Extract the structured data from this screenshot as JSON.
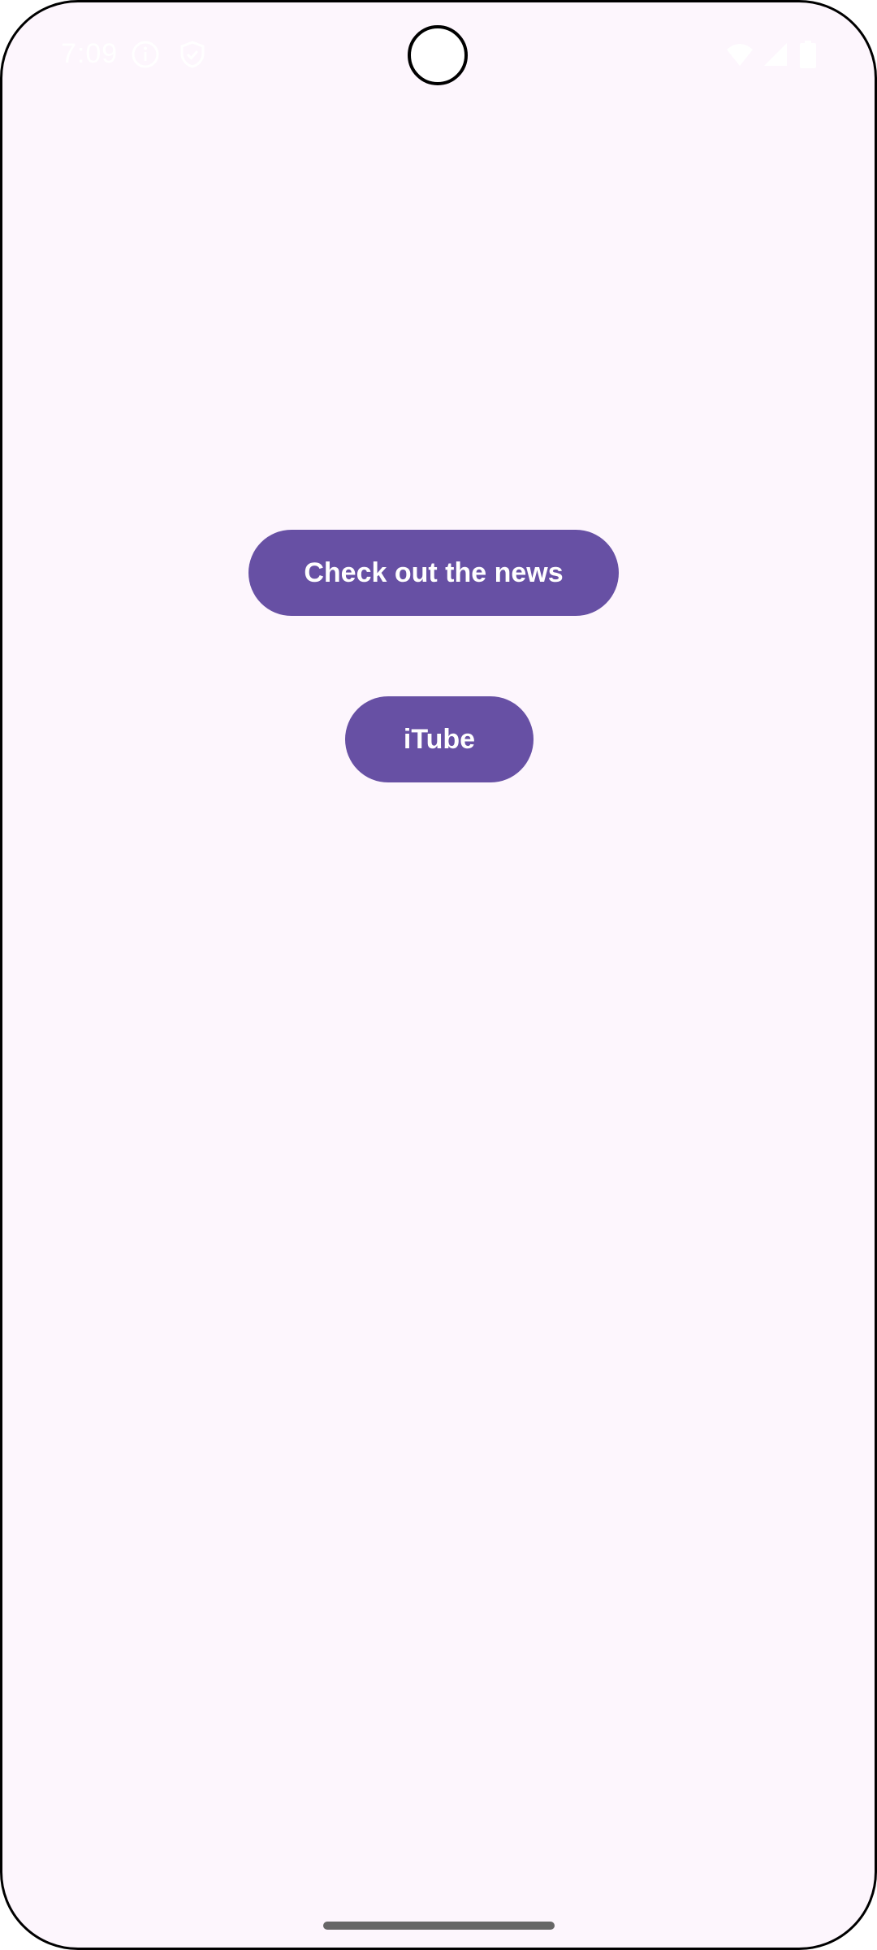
{
  "status_bar": {
    "time": "7:09",
    "icons": [
      "info-circle-icon",
      "shield-icon",
      "wifi-icon",
      "cellular-signal-icon",
      "battery-icon"
    ]
  },
  "main": {
    "news_button_label": "Check out the news",
    "itube_button_label": "iTube"
  },
  "colors": {
    "background": "#fdf6fd",
    "button": "#6750a4",
    "button_text": "#ffffff",
    "gesture_bar": "#666666"
  }
}
